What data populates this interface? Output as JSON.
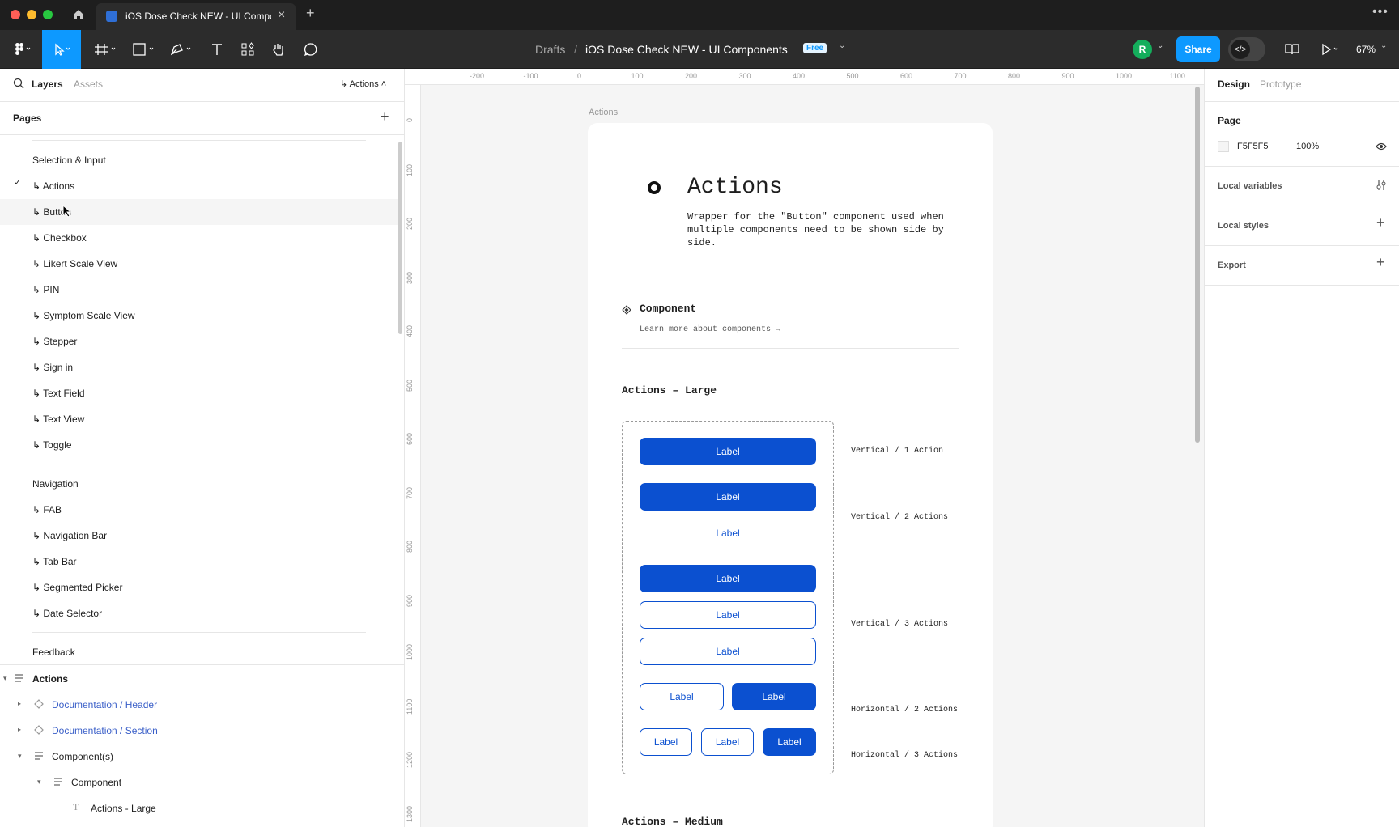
{
  "tab": {
    "title": "iOS Dose Check NEW - UI Components"
  },
  "toolbar": {
    "breadcrumb_root": "Drafts",
    "breadcrumb_sep": "/",
    "file_name": "iOS Dose Check NEW - UI Components",
    "plan_badge": "Free",
    "avatar_letter": "R",
    "share_label": "Share",
    "zoom": "67%"
  },
  "left": {
    "tabs": {
      "layers": "Layers",
      "assets": "Assets"
    },
    "current_page": "Actions",
    "pages_title": "Pages",
    "pages": {
      "p1": "Selection & Input",
      "p2": "↳ Actions",
      "p3": "↳ Button",
      "p4": "↳ Checkbox",
      "p5": "↳ Likert Scale View",
      "p6": "↳ PIN",
      "p7": "↳ Symptom Scale View",
      "p8": "↳ Stepper",
      "p9": "↳ Sign in",
      "p10": "↳ Text Field",
      "p11": "↳ Text View",
      "p12": "↳ Toggle",
      "p13": "Navigation",
      "p14": "↳ FAB",
      "p15": "↳ Navigation Bar",
      "p16": "↳ Tab Bar",
      "p17": "↳ Segmented Picker",
      "p18": "↳ Date Selector",
      "p19": "Feedback"
    },
    "layers": {
      "l1": "Actions",
      "l2": "Documentation / Header",
      "l3": "Documentation / Section",
      "l4": "Component(s)",
      "l5": "Component",
      "l6": "Actions - Large"
    }
  },
  "ruler": {
    "top": [
      "-200",
      "-100",
      "0",
      "100",
      "200",
      "300",
      "400",
      "500",
      "600",
      "700",
      "800",
      "900",
      "1000",
      "1100"
    ],
    "left": [
      "0",
      "100",
      "200",
      "300",
      "400",
      "500",
      "600",
      "700",
      "800",
      "900",
      "1000",
      "1100",
      "1200",
      "1300"
    ]
  },
  "canvas": {
    "frame_label": "Actions",
    "title": "Actions",
    "description": "Wrapper for the \"Button\" component used when multiple components need to be shown side by side.",
    "component_heading": "Component",
    "learn_more": "Learn more about components →",
    "section_large": "Actions – Large",
    "section_medium": "Actions – Medium",
    "button_label": "Label",
    "variants": {
      "v1": "Vertical / 1 Action",
      "v2": "Vertical / 2 Actions",
      "v3": "Vertical / 3 Actions",
      "h2": "Horizontal / 2 Actions",
      "h3": "Horizontal / 3 Actions"
    }
  },
  "right": {
    "tabs": {
      "design": "Design",
      "prototype": "Prototype"
    },
    "page_heading": "Page",
    "page_color": "F5F5F5",
    "page_opacity": "100%",
    "local_variables": "Local variables",
    "local_styles": "Local styles",
    "export": "Export"
  },
  "colors": {
    "accent": "#0d99ff",
    "button_blue": "#0b50d0",
    "avatar": "#14ae5c"
  }
}
